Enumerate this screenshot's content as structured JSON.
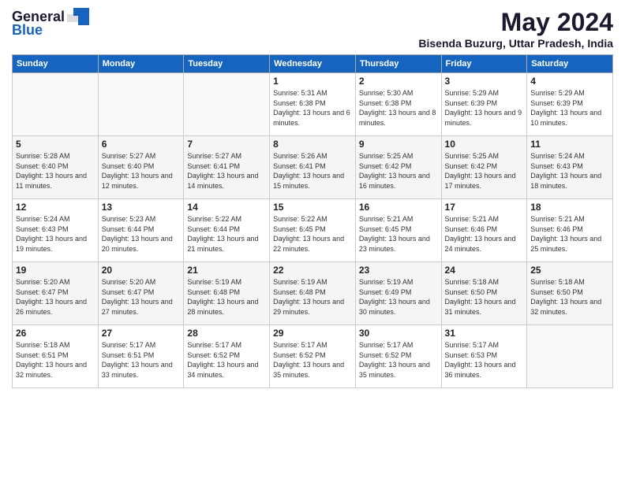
{
  "logo": {
    "general": "General",
    "blue": "Blue"
  },
  "header": {
    "month": "May 2024",
    "location": "Bisenda Buzurg, Uttar Pradesh, India"
  },
  "weekdays": [
    "Sunday",
    "Monday",
    "Tuesday",
    "Wednesday",
    "Thursday",
    "Friday",
    "Saturday"
  ],
  "weeks": [
    [
      {
        "day": "",
        "sunrise": "",
        "sunset": "",
        "daylight": ""
      },
      {
        "day": "",
        "sunrise": "",
        "sunset": "",
        "daylight": ""
      },
      {
        "day": "",
        "sunrise": "",
        "sunset": "",
        "daylight": ""
      },
      {
        "day": "1",
        "sunrise": "Sunrise: 5:31 AM",
        "sunset": "Sunset: 6:38 PM",
        "daylight": "Daylight: 13 hours and 6 minutes."
      },
      {
        "day": "2",
        "sunrise": "Sunrise: 5:30 AM",
        "sunset": "Sunset: 6:38 PM",
        "daylight": "Daylight: 13 hours and 8 minutes."
      },
      {
        "day": "3",
        "sunrise": "Sunrise: 5:29 AM",
        "sunset": "Sunset: 6:39 PM",
        "daylight": "Daylight: 13 hours and 9 minutes."
      },
      {
        "day": "4",
        "sunrise": "Sunrise: 5:29 AM",
        "sunset": "Sunset: 6:39 PM",
        "daylight": "Daylight: 13 hours and 10 minutes."
      }
    ],
    [
      {
        "day": "5",
        "sunrise": "Sunrise: 5:28 AM",
        "sunset": "Sunset: 6:40 PM",
        "daylight": "Daylight: 13 hours and 11 minutes."
      },
      {
        "day": "6",
        "sunrise": "Sunrise: 5:27 AM",
        "sunset": "Sunset: 6:40 PM",
        "daylight": "Daylight: 13 hours and 12 minutes."
      },
      {
        "day": "7",
        "sunrise": "Sunrise: 5:27 AM",
        "sunset": "Sunset: 6:41 PM",
        "daylight": "Daylight: 13 hours and 14 minutes."
      },
      {
        "day": "8",
        "sunrise": "Sunrise: 5:26 AM",
        "sunset": "Sunset: 6:41 PM",
        "daylight": "Daylight: 13 hours and 15 minutes."
      },
      {
        "day": "9",
        "sunrise": "Sunrise: 5:25 AM",
        "sunset": "Sunset: 6:42 PM",
        "daylight": "Daylight: 13 hours and 16 minutes."
      },
      {
        "day": "10",
        "sunrise": "Sunrise: 5:25 AM",
        "sunset": "Sunset: 6:42 PM",
        "daylight": "Daylight: 13 hours and 17 minutes."
      },
      {
        "day": "11",
        "sunrise": "Sunrise: 5:24 AM",
        "sunset": "Sunset: 6:43 PM",
        "daylight": "Daylight: 13 hours and 18 minutes."
      }
    ],
    [
      {
        "day": "12",
        "sunrise": "Sunrise: 5:24 AM",
        "sunset": "Sunset: 6:43 PM",
        "daylight": "Daylight: 13 hours and 19 minutes."
      },
      {
        "day": "13",
        "sunrise": "Sunrise: 5:23 AM",
        "sunset": "Sunset: 6:44 PM",
        "daylight": "Daylight: 13 hours and 20 minutes."
      },
      {
        "day": "14",
        "sunrise": "Sunrise: 5:22 AM",
        "sunset": "Sunset: 6:44 PM",
        "daylight": "Daylight: 13 hours and 21 minutes."
      },
      {
        "day": "15",
        "sunrise": "Sunrise: 5:22 AM",
        "sunset": "Sunset: 6:45 PM",
        "daylight": "Daylight: 13 hours and 22 minutes."
      },
      {
        "day": "16",
        "sunrise": "Sunrise: 5:21 AM",
        "sunset": "Sunset: 6:45 PM",
        "daylight": "Daylight: 13 hours and 23 minutes."
      },
      {
        "day": "17",
        "sunrise": "Sunrise: 5:21 AM",
        "sunset": "Sunset: 6:46 PM",
        "daylight": "Daylight: 13 hours and 24 minutes."
      },
      {
        "day": "18",
        "sunrise": "Sunrise: 5:21 AM",
        "sunset": "Sunset: 6:46 PM",
        "daylight": "Daylight: 13 hours and 25 minutes."
      }
    ],
    [
      {
        "day": "19",
        "sunrise": "Sunrise: 5:20 AM",
        "sunset": "Sunset: 6:47 PM",
        "daylight": "Daylight: 13 hours and 26 minutes."
      },
      {
        "day": "20",
        "sunrise": "Sunrise: 5:20 AM",
        "sunset": "Sunset: 6:47 PM",
        "daylight": "Daylight: 13 hours and 27 minutes."
      },
      {
        "day": "21",
        "sunrise": "Sunrise: 5:19 AM",
        "sunset": "Sunset: 6:48 PM",
        "daylight": "Daylight: 13 hours and 28 minutes."
      },
      {
        "day": "22",
        "sunrise": "Sunrise: 5:19 AM",
        "sunset": "Sunset: 6:48 PM",
        "daylight": "Daylight: 13 hours and 29 minutes."
      },
      {
        "day": "23",
        "sunrise": "Sunrise: 5:19 AM",
        "sunset": "Sunset: 6:49 PM",
        "daylight": "Daylight: 13 hours and 30 minutes."
      },
      {
        "day": "24",
        "sunrise": "Sunrise: 5:18 AM",
        "sunset": "Sunset: 6:50 PM",
        "daylight": "Daylight: 13 hours and 31 minutes."
      },
      {
        "day": "25",
        "sunrise": "Sunrise: 5:18 AM",
        "sunset": "Sunset: 6:50 PM",
        "daylight": "Daylight: 13 hours and 32 minutes."
      }
    ],
    [
      {
        "day": "26",
        "sunrise": "Sunrise: 5:18 AM",
        "sunset": "Sunset: 6:51 PM",
        "daylight": "Daylight: 13 hours and 32 minutes."
      },
      {
        "day": "27",
        "sunrise": "Sunrise: 5:17 AM",
        "sunset": "Sunset: 6:51 PM",
        "daylight": "Daylight: 13 hours and 33 minutes."
      },
      {
        "day": "28",
        "sunrise": "Sunrise: 5:17 AM",
        "sunset": "Sunset: 6:52 PM",
        "daylight": "Daylight: 13 hours and 34 minutes."
      },
      {
        "day": "29",
        "sunrise": "Sunrise: 5:17 AM",
        "sunset": "Sunset: 6:52 PM",
        "daylight": "Daylight: 13 hours and 35 minutes."
      },
      {
        "day": "30",
        "sunrise": "Sunrise: 5:17 AM",
        "sunset": "Sunset: 6:52 PM",
        "daylight": "Daylight: 13 hours and 35 minutes."
      },
      {
        "day": "31",
        "sunrise": "Sunrise: 5:17 AM",
        "sunset": "Sunset: 6:53 PM",
        "daylight": "Daylight: 13 hours and 36 minutes."
      },
      {
        "day": "",
        "sunrise": "",
        "sunset": "",
        "daylight": ""
      }
    ]
  ]
}
